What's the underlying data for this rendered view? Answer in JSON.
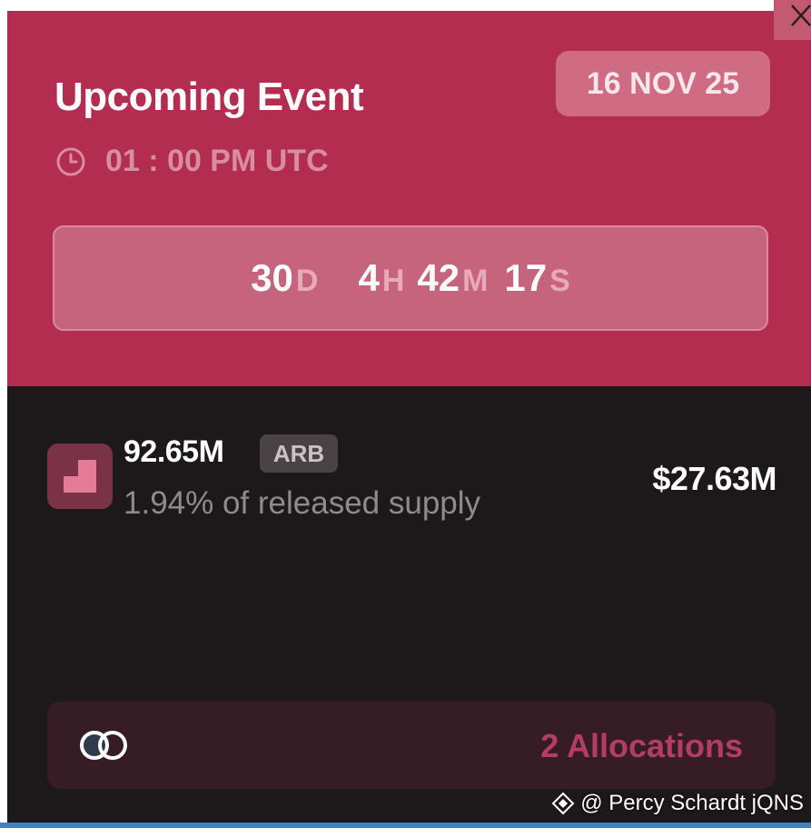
{
  "header": {
    "title": "Upcoming Event",
    "date": "16 NOV 25",
    "time": "01 : 00 PM UTC"
  },
  "countdown": [
    {
      "value": "30",
      "unit": "D"
    },
    {
      "value": "4",
      "unit": "H"
    },
    {
      "value": "42",
      "unit": "M"
    },
    {
      "value": "17",
      "unit": "S"
    }
  ],
  "unlock": {
    "amount": "92.65M",
    "symbol": "ARB",
    "supply_text": "1.94% of released supply",
    "usd_value": "$27.63M"
  },
  "allocations": {
    "label": "2 Allocations"
  },
  "watermark": {
    "text": "@ Percy Schardt jQNS"
  },
  "colors": {
    "header_bg": "#b22d4f",
    "body_bg": "#1d191b",
    "accent": "#b33d64"
  },
  "icons": {
    "close": "close-icon",
    "clock": "clock-icon",
    "token": "arbitrum-token-icon",
    "allocations": "allocations-circles-icon"
  }
}
